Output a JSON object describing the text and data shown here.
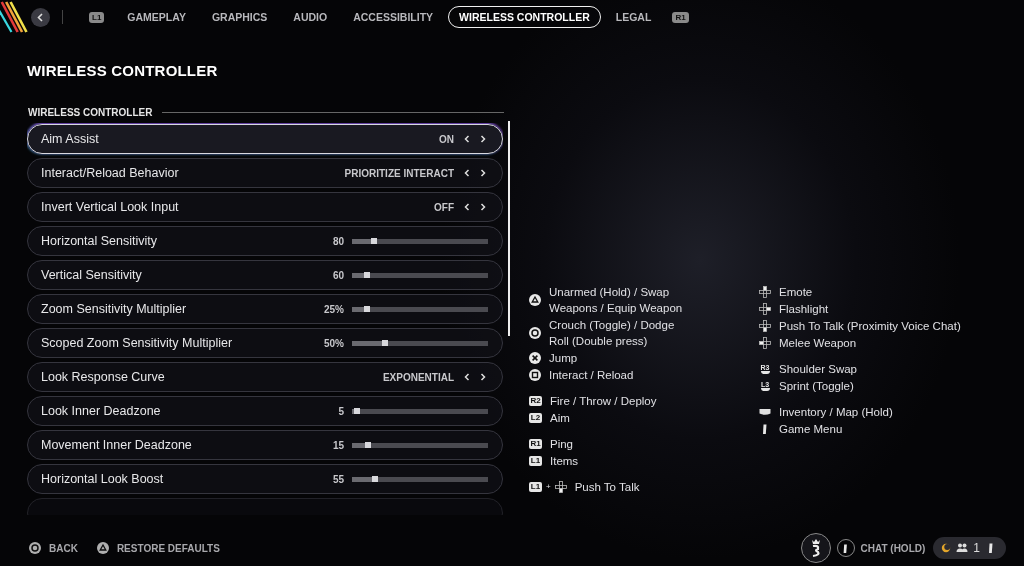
{
  "top_bar": {
    "left_shoulder": "L1",
    "right_shoulder": "R1",
    "tabs": [
      {
        "label": "GAMEPLAY",
        "selected": false
      },
      {
        "label": "GRAPHICS",
        "selected": false
      },
      {
        "label": "AUDIO",
        "selected": false
      },
      {
        "label": "ACCESSIBILITY",
        "selected": false
      },
      {
        "label": "WIRELESS CONTROLLER",
        "selected": true
      },
      {
        "label": "LEGAL",
        "selected": false
      }
    ]
  },
  "page_title": "WIRELESS CONTROLLER",
  "section": {
    "title": "WIRELESS CONTROLLER",
    "more_below": true,
    "rows": [
      {
        "kind": "choice",
        "label": "Aim Assist",
        "value": "ON",
        "selected": true
      },
      {
        "kind": "choice",
        "label": "Interact/Reload Behavior",
        "value": "PRIORITIZE INTERACT",
        "selected": false
      },
      {
        "kind": "choice",
        "label": "Invert Vertical Look Input",
        "value": "OFF",
        "selected": false
      },
      {
        "kind": "slider",
        "label": "Horizontal Sensitivity",
        "reading": "80",
        "level": 0.16,
        "selected": false
      },
      {
        "kind": "slider",
        "label": "Vertical Sensitivity",
        "reading": "60",
        "level": 0.11,
        "selected": false
      },
      {
        "kind": "slider",
        "label": "Zoom Sensitivity Multiplier",
        "reading": "25%",
        "level": 0.11,
        "selected": false
      },
      {
        "kind": "slider",
        "label": "Scoped Zoom Sensitivity Multiplier",
        "reading": "50%",
        "level": 0.24,
        "selected": false
      },
      {
        "kind": "choice",
        "label": "Look Response Curve",
        "value": "EXPONENTIAL",
        "selected": false
      },
      {
        "kind": "slider",
        "label": "Look Inner Deadzone",
        "reading": "5",
        "level": 0.04,
        "selected": false
      },
      {
        "kind": "slider",
        "label": "Movement Inner Deadzone",
        "reading": "15",
        "level": 0.12,
        "selected": false
      },
      {
        "kind": "slider",
        "label": "Horizontal Look Boost",
        "reading": "55",
        "level": 0.17,
        "selected": false
      }
    ]
  },
  "controls_legend": {
    "columns": [
      [
        [
          {
            "kind": "triangle",
            "text": "Unarmed (Hold) / Swap Weapons / Equip Weapon"
          },
          {
            "kind": "circle",
            "text": "Crouch (Toggle) / Dodge Roll (Double press)"
          },
          {
            "kind": "cross",
            "text": "Jump"
          },
          {
            "kind": "square",
            "text": "Interact / Reload"
          }
        ],
        [
          {
            "kind": "badge",
            "label": "R2",
            "text": "Fire / Throw / Deploy"
          },
          {
            "kind": "badge",
            "label": "L2",
            "text": "Aim"
          }
        ],
        [
          {
            "kind": "badge",
            "label": "R1",
            "text": "Ping"
          },
          {
            "kind": "badge",
            "label": "L1",
            "text": "Items"
          }
        ],
        [
          {
            "kind": "combo_dpad_down",
            "label": "L1",
            "joiner": "+",
            "text": "Push To Talk"
          }
        ]
      ],
      [
        [
          {
            "kind": "dpad_up",
            "text": "Emote"
          },
          {
            "kind": "dpad_right",
            "text": "Flashlight"
          },
          {
            "kind": "dpad_down",
            "text": "Push To Talk (Proximity Voice Chat)"
          },
          {
            "kind": "dpad_left",
            "text": "Melee Weapon"
          }
        ],
        [
          {
            "kind": "stick",
            "label": "R3",
            "text": "Shoulder Swap"
          },
          {
            "kind": "stick",
            "label": "L3",
            "text": "Sprint (Toggle)"
          }
        ],
        [
          {
            "kind": "touchpad",
            "text": "Inventory / Map (Hold)"
          },
          {
            "kind": "options",
            "text": "Game Menu"
          }
        ]
      ]
    ]
  },
  "footer": {
    "actions": [
      {
        "kind": "circle",
        "label": "BACK"
      },
      {
        "kind": "triangle",
        "label": "RESTORE DEFAULTS"
      }
    ],
    "chat_hint": "CHAT (HOLD)",
    "party_count": "1"
  }
}
